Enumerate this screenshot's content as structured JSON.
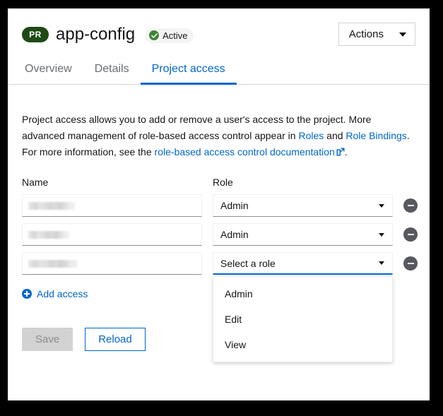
{
  "header": {
    "resource_badge": "PR",
    "title": "app-config",
    "status": "Active",
    "status_color": "#3e8635",
    "badge_color": "#1f4a16",
    "actions_label": "Actions"
  },
  "tabs": [
    {
      "label": "Overview",
      "active": false
    },
    {
      "label": "Details",
      "active": false
    },
    {
      "label": "Project access",
      "active": true
    }
  ],
  "accent_color": "#0066cc",
  "description": {
    "part1": "Project access allows you to add or remove a user's access to the project. More advanced management of role-based access control appear in ",
    "link_roles": "Roles",
    "part2": " and ",
    "link_role_bindings": "Role Bindings",
    "part3": ". For more information, see the ",
    "link_docs": "role-based access control documentation",
    "part4": "."
  },
  "table": {
    "headers": {
      "name": "Name",
      "role": "Role"
    },
    "rows": [
      {
        "name_value": "",
        "name_redacted": true,
        "role_value": "Admin",
        "role_expanded": false,
        "remove_label": "Remove"
      },
      {
        "name_value": "",
        "name_redacted": true,
        "role_value": "Admin",
        "role_expanded": false,
        "remove_label": "Remove"
      },
      {
        "name_value": "",
        "name_redacted": true,
        "role_value": "Select a role",
        "role_expanded": true,
        "remove_label": "Remove"
      }
    ]
  },
  "role_options": [
    "Admin",
    "Edit",
    "View"
  ],
  "add_access_label": "Add access",
  "buttons": {
    "save": "Save",
    "save_disabled": true,
    "reload": "Reload"
  },
  "icons": {
    "caret": "chevron-down-icon",
    "check": "check-circle-icon",
    "minus": "minus-circle-icon",
    "plus": "plus-circle-icon",
    "external": "external-link-icon"
  }
}
